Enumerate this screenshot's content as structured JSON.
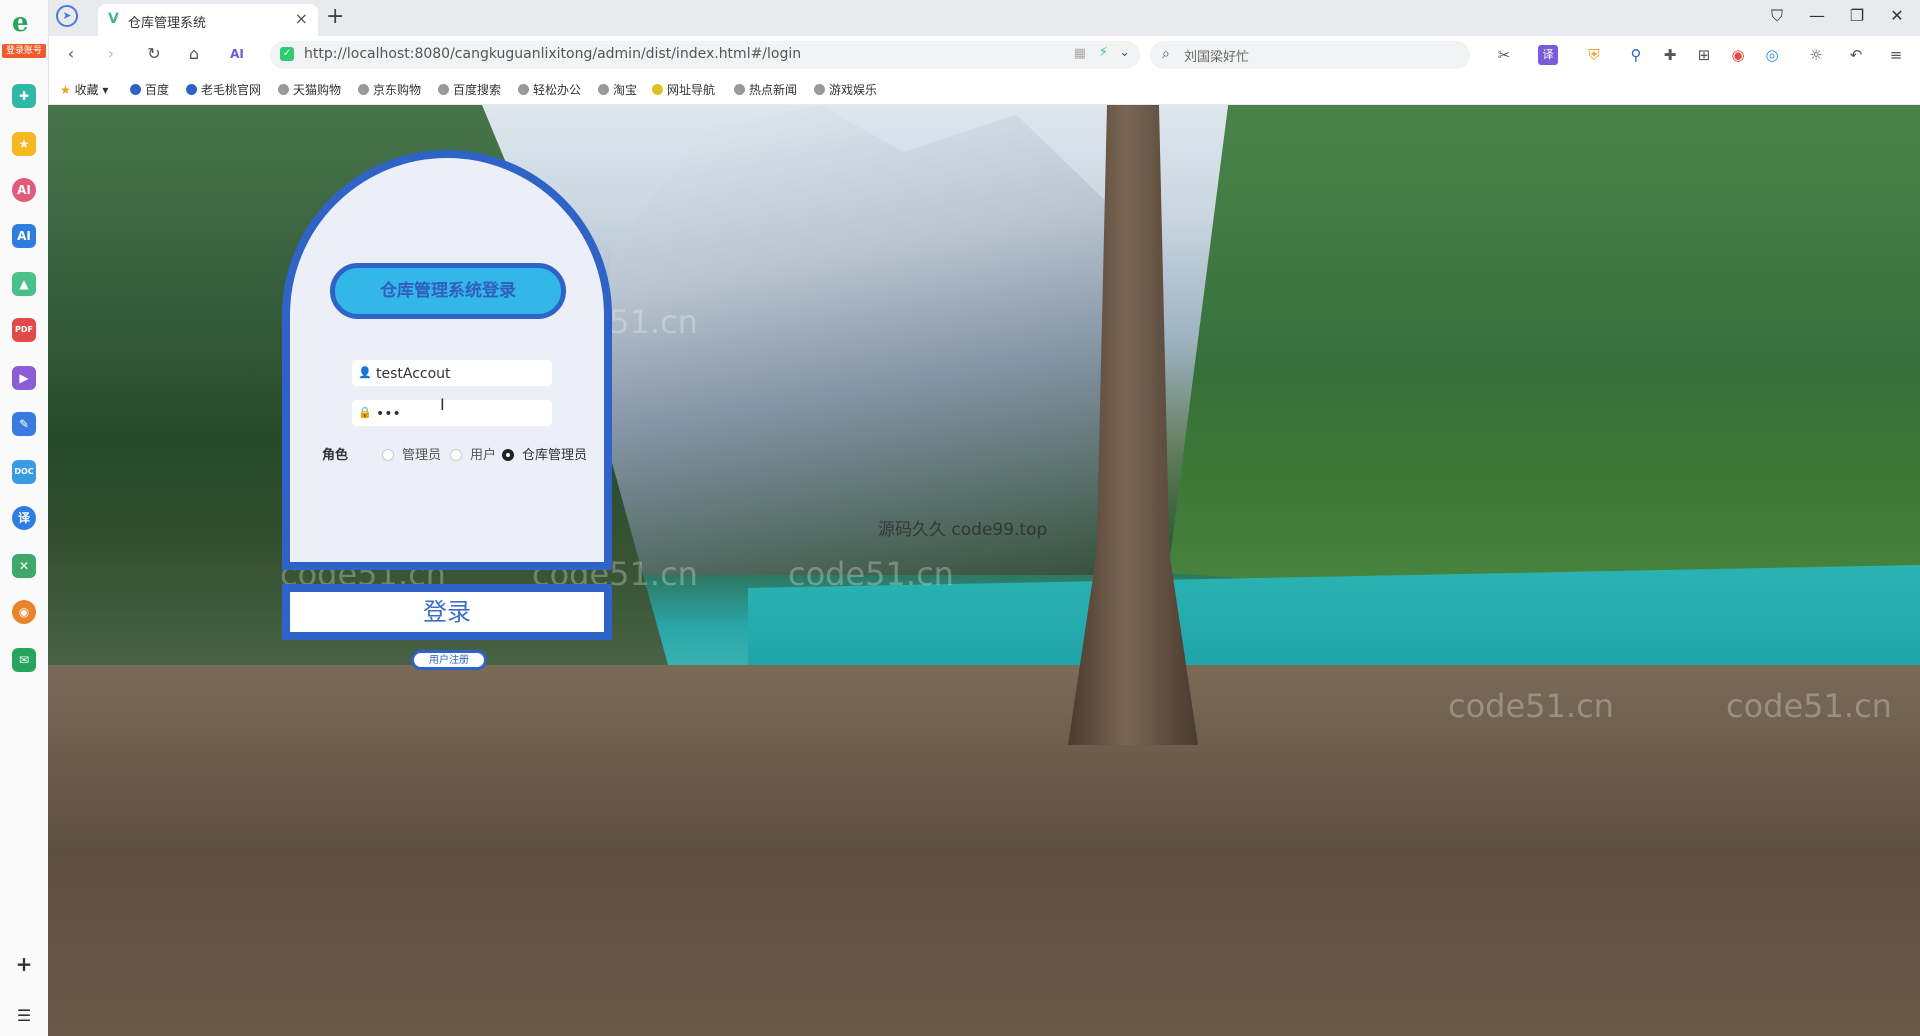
{
  "browser": {
    "tab_title": "仓库管理系统",
    "url": "http://localhost:8080/cangkuguanlixitong/admin/dist/index.html#/login",
    "search_text": "刘国梁好忙",
    "sidebar_badge": "登录账号"
  },
  "bookmarks": [
    "收藏",
    "百度",
    "老毛桃官网",
    "天猫购物",
    "京东购物",
    "百度搜索",
    "轻松办公",
    "淘宝",
    "网址导航",
    "热点新闻",
    "游戏娱乐"
  ],
  "watermark": "code51.cn",
  "watermark_center": "源码久久 code99.top",
  "login": {
    "title": "仓库管理系统登录",
    "username_value": "testAccout",
    "password_value": "•••",
    "role_label": "角色",
    "roles": [
      "管理员",
      "用户",
      "仓库管理员"
    ],
    "selected_role": "仓库管理员",
    "submit_label": "登录",
    "register_label": "用户注册"
  }
}
